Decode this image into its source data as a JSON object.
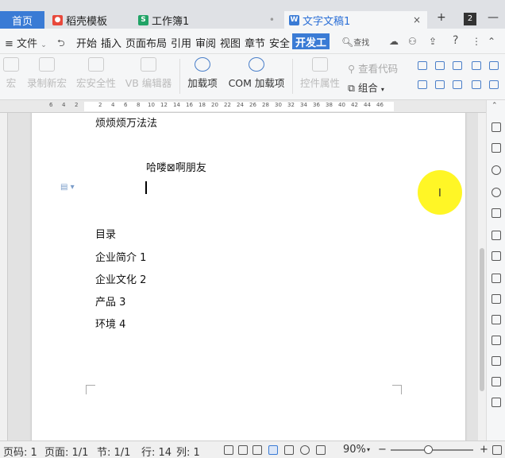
{
  "tabs": {
    "home": "首页",
    "items": [
      {
        "label": "稻壳模板",
        "icon": "docer-icon",
        "color": "#e8483b"
      },
      {
        "label": "工作簿1",
        "icon": "spreadsheet-icon",
        "color": "#21a366"
      },
      {
        "label": "文字文稿1",
        "icon": "writer-icon",
        "color": "#3a7bd5"
      }
    ],
    "add": "+",
    "window_badge": "2"
  },
  "menu": {
    "file": "文件",
    "items": [
      "开始",
      "插入",
      "页面布局",
      "引用",
      "审阅",
      "视图",
      "章节",
      "安全"
    ],
    "active": "开发工",
    "search": "查找",
    "help": "?"
  },
  "ribbon": {
    "macro": "宏",
    "record_macro": "录制新宏",
    "macro_security": "宏安全性",
    "vb_editor": "VB 编辑器",
    "addins": "加载项",
    "com_addins": "COM 加载项",
    "control_props": "控件属性",
    "view_code": "查看代码",
    "group": "组合"
  },
  "ruler": {
    "numbers": [
      "6",
      "4",
      "2",
      "2",
      "4",
      "6",
      "8",
      "10",
      "12",
      "14",
      "16",
      "18",
      "20",
      "22",
      "24",
      "26",
      "28",
      "30",
      "32",
      "34",
      "36",
      "38",
      "40",
      "42",
      "44",
      "46"
    ]
  },
  "document": {
    "top_line": "烦烦烦万法法",
    "greeting": "哈喽⊠啊朋友",
    "toc_title": "目录",
    "toc": [
      "企业简介 1",
      "企业文化 2",
      "产品 3",
      "环境 4"
    ]
  },
  "status": {
    "page_code": "页码: 1",
    "pages": "页面: 1/1",
    "section": "节: 1/1",
    "row": "行: 14",
    "col": "列: 1",
    "zoom": "90%"
  },
  "colors": {
    "accent": "#3a7bd5",
    "highlight": "#fff500"
  }
}
